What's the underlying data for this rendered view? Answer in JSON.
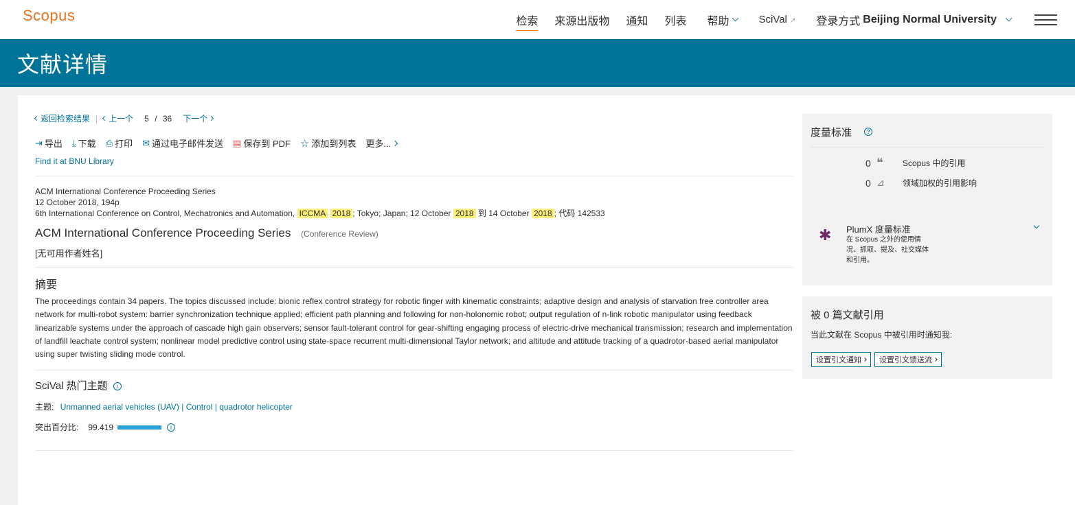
{
  "header": {
    "logo": "Scopus",
    "nav": {
      "search": "检索",
      "sources": "来源出版物",
      "alerts": "通知",
      "lists": "列表",
      "help": "帮助",
      "scival": "SciVal",
      "login_prefix": "登录方式",
      "institution": "Beijing Normal University"
    }
  },
  "banner": {
    "title": "文献详情"
  },
  "result_nav": {
    "back": "返回检索结果",
    "prev": "上一个",
    "current": "5",
    "separator": "/",
    "total": "36",
    "next": "下一个"
  },
  "toolbar": {
    "export": "导出",
    "download": "下载",
    "print": "打印",
    "email": "通过电子邮件发送",
    "pdf": "保存到 PDF",
    "add_list": "添加到列表",
    "more": "更多..."
  },
  "library_link": "Find it at BNU Library",
  "meta": {
    "series": "ACM International Conference Proceeding Series",
    "date_pages": "12 October 2018, 194p",
    "conf_prefix": "6th International Conference on Control, Mechatronics and Automation,",
    "hl_iccma": "ICCMA",
    "hl_year1": "2018",
    "conf_mid": "; Tokyo; Japan; 12 October",
    "hl_year2": "2018",
    "conf_to": "到 14 October",
    "hl_year3": "2018",
    "conf_code": "; 代码 142533"
  },
  "document": {
    "title": "ACM International Conference Proceeding Series",
    "type": "(Conference Review)",
    "authors": "[无可用作者姓名]"
  },
  "abstract": {
    "heading": "摘要",
    "text": "The proceedings contain 34 papers. The topics discussed include: bionic reflex control strategy for robotic finger with kinematic constraints; adaptive design and analysis of starvation free controller area network for multi-robot system: barrier synchronization technique applied; efficient path planning and following for non-holonomic robot; output regulation of n-link robotic manipulator using feedback linearizable systems under the approach of cascade high gain observers; sensor fault-tolerant control for gear-shifting engaging process of electric-drive mechanical transmission; research and implementation of landfill leachate control system; nonlinear model predictive control using state-space recurrent multi-dimensional Taylor network; and altitude and attitude tracking of a quadrotor-based aerial manipulator using super twisting sliding mode control."
  },
  "scival": {
    "heading": "SciVal 热门主题",
    "topic_label": "主题:",
    "topic_1": "Unmanned aerial vehicles (UAV)",
    "topic_sep1": "|",
    "topic_2": "Control",
    "topic_sep2": "|",
    "topic_3": "quadrotor helicopter",
    "pct_label": "突出百分比:",
    "pct_value": "99.419",
    "pct_fraction": 0.99419
  },
  "metrics": {
    "heading": "度量标准",
    "citations_num": "0",
    "citations_label": "Scopus 中的引用",
    "fwci_num": "0",
    "fwci_label": "领域加权的引用影响",
    "plumx_title": "PlumX 度量标准",
    "plumx_desc": "在 Scopus 之外的使用情况、抓取、提及、社交媒体和引用。"
  },
  "cited_by": {
    "heading": "被 0 篇文献引用",
    "desc": "当此文献在 Scopus 中被引用时通知我:",
    "btn_alert": "设置引文通知",
    "btn_feed": "设置引文馈送流"
  }
}
